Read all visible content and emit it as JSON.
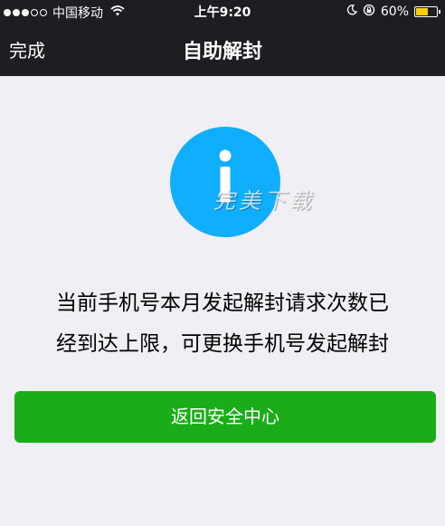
{
  "status_bar": {
    "carrier": "中国移动",
    "time": "上午9:20",
    "battery": "60%",
    "battery_level": 0.6,
    "signal_bars_full": 3,
    "signal_bars_total": 5,
    "icons": [
      "wifi-icon",
      "moon-icon",
      "rotation-lock-icon",
      "battery-icon"
    ]
  },
  "nav": {
    "done_label": "完成",
    "title": "自助解封"
  },
  "info_icon": {
    "name": "info-icon",
    "color": "#10aeff"
  },
  "watermark": "完美下载",
  "message": {
    "line1": "当前手机号本月发起解封请求次数已",
    "line2": "经到达上限，可更换手机号发起解封"
  },
  "button": {
    "label": "返回安全中心",
    "color": "#1aad19"
  }
}
